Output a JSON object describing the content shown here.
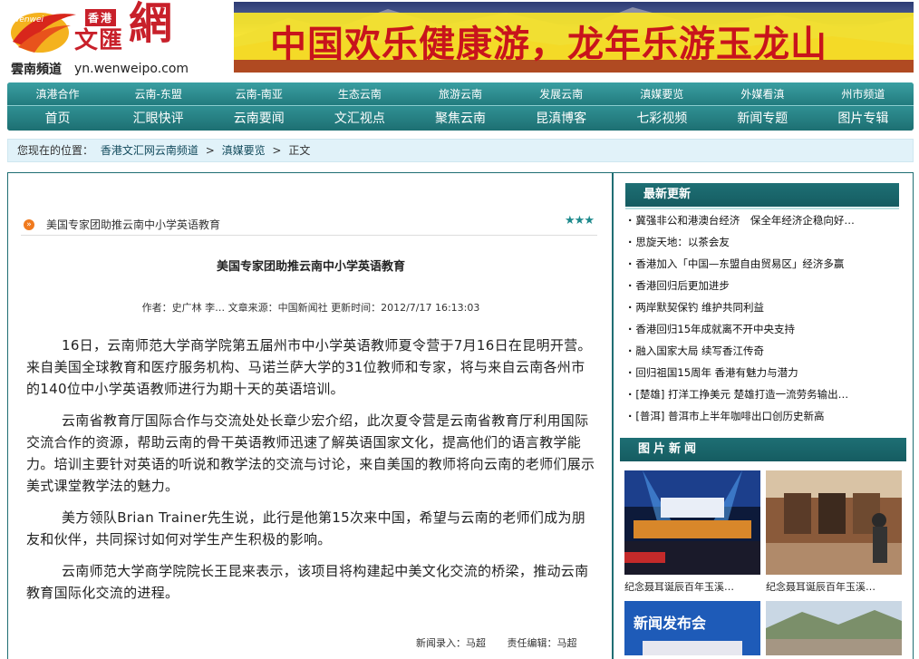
{
  "header": {
    "logo_hk": "香港",
    "logo_wenhui": "文匯",
    "logo_wang": "網",
    "channel": "雲南頻道",
    "url": "yn.wenweipo.com",
    "banner_slogan": "中国欢乐健康游，龙年乐游玉龙山"
  },
  "nav": {
    "row1": [
      "滇港合作",
      "云南-东盟",
      "云南-南亚",
      "生态云南",
      "旅游云南",
      "发展云南",
      "滇媒要览",
      "外媒看滇",
      "州市频道"
    ],
    "row2": [
      "首页",
      "汇眼快评",
      "云南要闻",
      "文汇视点",
      "聚焦云南",
      "昆滇博客",
      "七彩视频",
      "新闻专题",
      "图片专辑"
    ]
  },
  "breadcrumb": {
    "label": "您现在的位置：",
    "items": [
      "香港文汇网云南频道",
      "滇媒要览",
      "正文"
    ],
    "sep": ">"
  },
  "article": {
    "list_title": "美国专家团助推云南中小学英语教育",
    "stars": "★★★",
    "headline": "美国专家团助推云南中小学英语教育",
    "meta": "作者：史广林 李… 文章来源：中国新闻社 更新时间：2012/7/17 16:13:03",
    "paragraphs": [
      "16日，云南师范大学商学院第五届州市中小学英语教师夏令营于7月16日在昆明开营。来自美国全球教育和医疗服务机构、马诺兰萨大学的31位教师和专家，将与来自云南各州市的140位中小学英语教师进行为期十天的英语培训。",
      "云南省教育厅国际合作与交流处处长章少宏介绍，此次夏令营是云南省教育厅利用国际交流合作的资源，帮助云南的骨干英语教师迅速了解英语国家文化，提高他们的语言教学能力。培训主要针对英语的听说和教学法的交流与讨论，来自美国的教师将向云南的老师们展示美式课堂教学法的魅力。",
      "美方领队Brian Trainer先生说，此行是他第15次来中国，希望与云南的老师们成为朋友和伙伴，共同探讨如何对学生产生积极的影响。",
      "云南师范大学商学院院长王昆来表示，该项目将构建起中美文化交流的桥梁，推动云南教育国际化交流的进程。"
    ],
    "entry_editor": "新闻录入：马超",
    "responsible_editor": "责任编辑：马超"
  },
  "sidebar": {
    "latest_title": "最新更新",
    "latest": [
      "冀强非公和港澳台经济　保全年经济企稳向好…",
      "思旋天地：以茶会友",
      "香港加入「中国—东盟自由贸易区」经济多赢",
      "香港回归后更加进步",
      "两岸默契保钓 维护共同利益",
      "香港回归15年成就离不开中央支持",
      "融入国家大局 续写香江传奇",
      "回归祖国15周年 香港有魅力与潜力",
      "[楚雄] 打洋工挣美元 楚雄打造一流劳务输出…",
      "[普洱] 普洱市上半年咖啡出口创历史新高"
    ],
    "photo_title": "图片新闻",
    "photos": [
      {
        "caption": "纪念聂耳诞辰百年玉溪…"
      },
      {
        "caption": "纪念聂耳诞辰百年玉溪…"
      },
      {
        "caption": "新闻发布会"
      },
      {
        "caption": ""
      }
    ]
  },
  "colors": {
    "nav_teal": "#2a8a8d",
    "brand_red": "#c8202a",
    "crumb_bg": "#e1f2f9",
    "star_teal": "#1f8a8d"
  }
}
